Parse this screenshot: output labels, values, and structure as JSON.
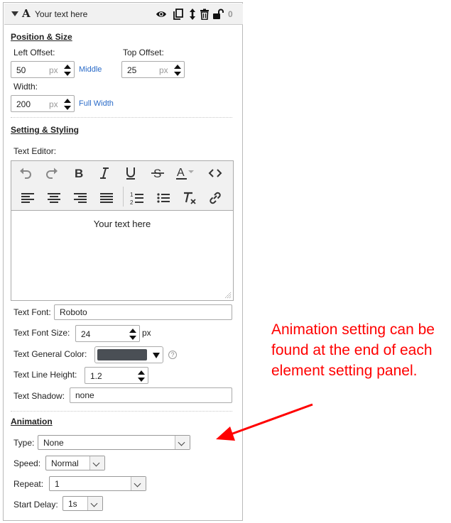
{
  "header": {
    "type_glyph": "A",
    "title": "Your text here",
    "count": "0",
    "icons": [
      "chevron-down-icon",
      "eye-icon",
      "copy-icon",
      "move-vertical-icon",
      "trash-icon",
      "unlock-icon"
    ]
  },
  "position_size": {
    "title": "Position & Size",
    "left_offset": {
      "label": "Left Offset:",
      "value": "50",
      "unit": "px",
      "hint": "Middle"
    },
    "top_offset": {
      "label": "Top Offset:",
      "value": "25",
      "unit": "px"
    },
    "width": {
      "label": "Width:",
      "value": "200",
      "unit": "px",
      "hint": "Full Width"
    }
  },
  "setting_styling": {
    "title": "Setting & Styling",
    "text_editor_label": "Text Editor:",
    "toolbar_row1": [
      "undo-icon",
      "redo-icon",
      "bold-icon",
      "italic-icon",
      "underline-icon",
      "strikethrough-icon",
      "font-color-icon",
      "code-icon"
    ],
    "toolbar_row2": [
      "align-left-icon",
      "align-center-icon",
      "align-right-icon",
      "align-justify-icon",
      "ordered-list-icon",
      "unordered-list-icon",
      "clear-format-icon",
      "link-icon"
    ],
    "editor_content": "Your text here",
    "text_font": {
      "label": "Text Font:",
      "value": "Roboto"
    },
    "text_font_size": {
      "label": "Text Font Size:",
      "value": "24",
      "unit": "px"
    },
    "text_general_color": {
      "label": "Text General Color:",
      "value": "#4a4f55",
      "help": "?"
    },
    "text_line_height": {
      "label": "Text Line Height:",
      "value": "1.2"
    },
    "text_shadow": {
      "label": "Text Shadow:",
      "value": "none"
    }
  },
  "animation": {
    "title": "Animation",
    "type": {
      "label": "Type:",
      "value": "None"
    },
    "speed": {
      "label": "Speed:",
      "value": "Normal"
    },
    "repeat": {
      "label": "Repeat:",
      "value": "1"
    },
    "start_delay": {
      "label": "Start Delay:",
      "value": "1s"
    }
  },
  "annotation": {
    "text": "Animation setting can be found at the end of each element setting panel.",
    "color": "#ff0000"
  }
}
